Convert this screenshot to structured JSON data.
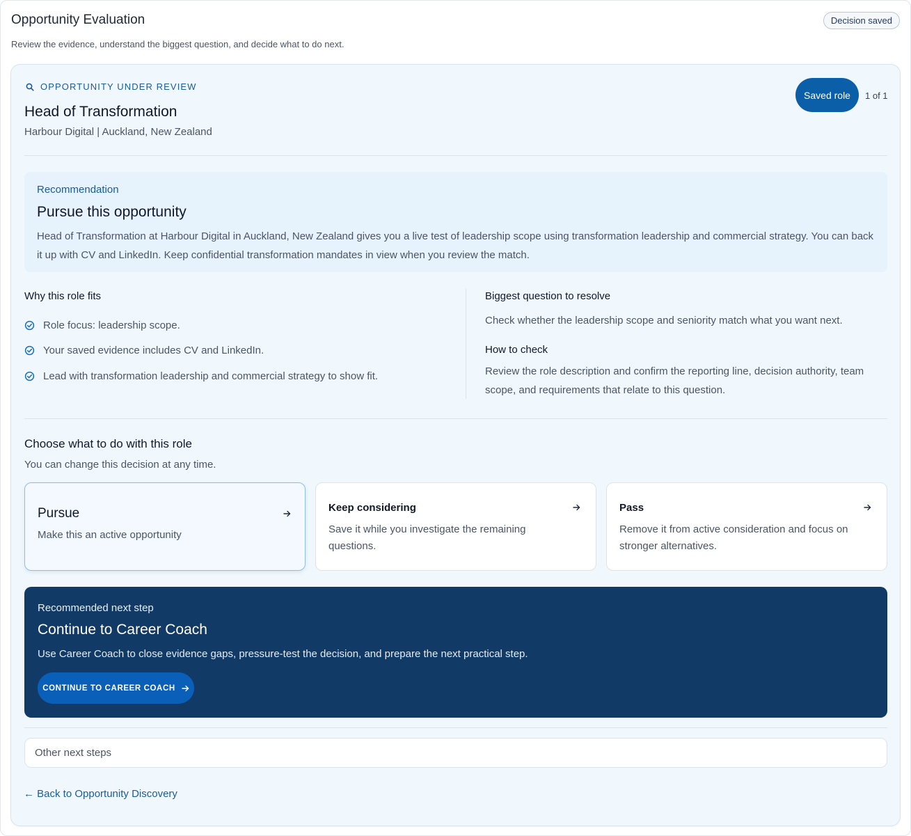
{
  "header": {
    "title": "Opportunity Evaluation",
    "subtitle": "Review the evidence, understand the biggest question, and decide what to do next.",
    "status": "Decision saved"
  },
  "opportunity": {
    "eyebrow": "OPPORTUNITY UNDER REVIEW",
    "eyebrow_icon": "search-icon",
    "title": "Head of Transformation",
    "meta": "Harbour Digital | Auckland, New Zealand",
    "saved_label": "Saved role",
    "pager": "1 of 1"
  },
  "recommendation": {
    "label": "Recommendation",
    "title": "Pursue this opportunity",
    "text": "Head of Transformation at Harbour Digital in Auckland, New Zealand gives you a live test of leadership scope using transformation leadership and commercial strategy. You can back it up with CV and LinkedIn. Keep confidential transformation mandates in view when you review the match."
  },
  "fit": {
    "heading": "Why this role fits",
    "items": [
      "Role focus: leadership scope.",
      "Your saved evidence includes CV and LinkedIn.",
      "Lead with transformation leadership and commercial strategy to show fit."
    ],
    "icon": "check-circle-icon"
  },
  "question": {
    "heading": "Biggest question to resolve",
    "text": "Check whether the leadership scope and seniority match what you want next.",
    "how_heading": "How to check",
    "how_text": "Review the role description and confirm the reporting line, decision authority, team scope, and requirements that relate to this question."
  },
  "decision": {
    "title": "Choose what to do with this role",
    "subtitle": "You can change this decision at any time.",
    "options": [
      {
        "title": "Pursue",
        "desc": "Make this an active opportunity",
        "selected": true
      },
      {
        "title": "Keep considering",
        "desc": "Save it while you investigate the remaining questions.",
        "selected": false
      },
      {
        "title": "Pass",
        "desc": "Remove it from active consideration and focus on stronger alternatives.",
        "selected": false
      }
    ]
  },
  "next_step": {
    "label": "Recommended next step",
    "title": "Continue to Career Coach",
    "text": "Use Career Coach to close evidence gaps, pressure-test the decision, and prepare the next practical step.",
    "button": "CONTINUE TO CAREER COACH"
  },
  "other_steps": "Other next steps",
  "back_link": "← Back to Opportunity Discovery",
  "colors": {
    "accent": "#0b5ea8",
    "dark_panel": "#123a66",
    "card_bg": "#f1f8fd"
  }
}
